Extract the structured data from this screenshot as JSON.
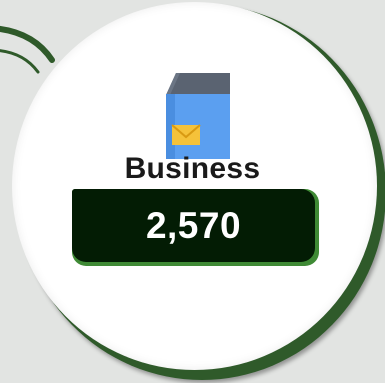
{
  "stat": {
    "icon": "mailbox-icon",
    "label": "Business",
    "value": "2,570"
  },
  "colors": {
    "background": "#e2e4e2",
    "ring": "#2f5a2a",
    "card": "#ffffff",
    "value_box": "#031c04",
    "value_box_edge": "#3f8a35",
    "mailbox_body": "#5b9ff0",
    "mailbox_roof": "#5a6371",
    "envelope": "#f5c23a",
    "label_text": "#1a1a1a",
    "value_text": "#ffffff"
  }
}
